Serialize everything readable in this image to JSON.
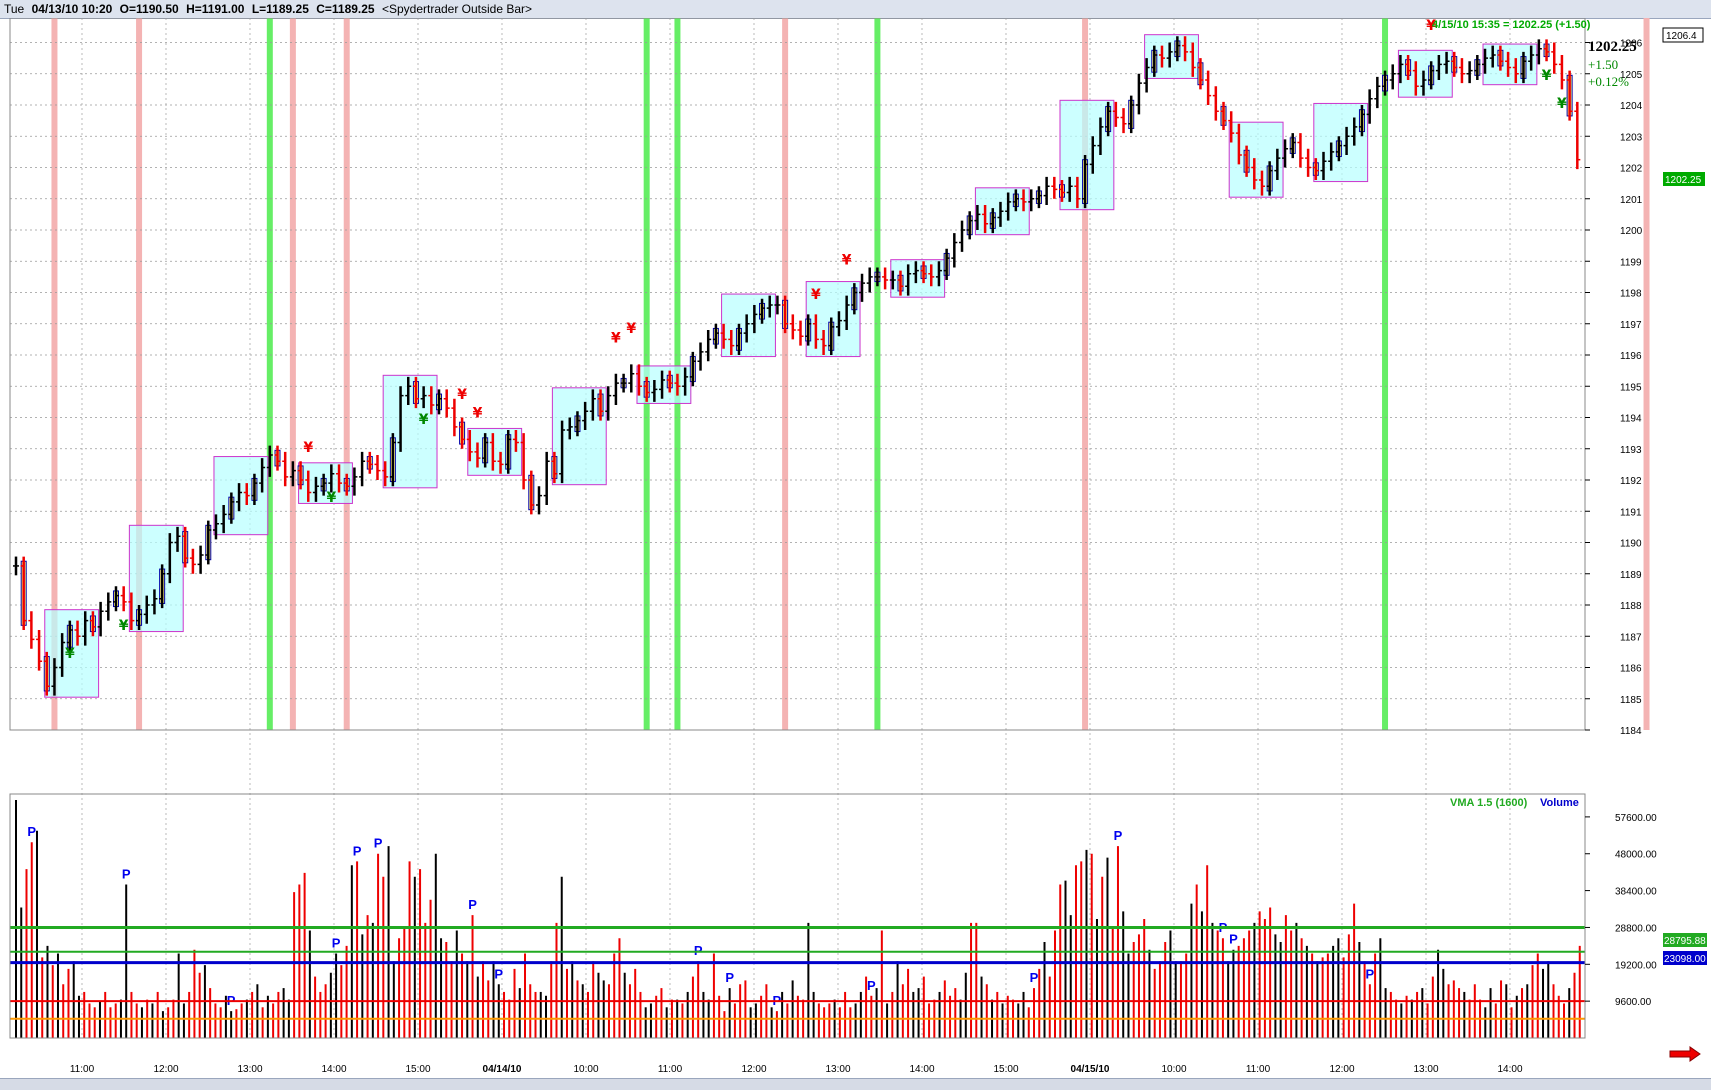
{
  "header": {
    "day": "Tue",
    "date_time": "04/13/10 10:20",
    "open": "O=1190.50",
    "high": "H=1191.00",
    "low": "L=1189.25",
    "close": "C=1189.25",
    "study": "<Spydertrader Outside Bar>"
  },
  "quote": {
    "timestamp": "4/15/10 15:35 = 1202.25 (+1.50)",
    "last": "1202.25",
    "change": "+1.50",
    "change_pct": "+0.12%",
    "axis_high_label": "1206.4",
    "axis_last_label": "1202.25"
  },
  "volume_panel": {
    "vma_label": "VMA 1.5 (1600)",
    "volume_label": "Volume",
    "vma_value_label": "28795.88",
    "volume_value_label": "23098.00"
  },
  "colors": {
    "up_bar": "#000000",
    "down_bar": "#ee0000",
    "inside_bar_fill": "#fff27a",
    "box_fill": "#b7ffff",
    "box_border": "#cc33cc",
    "green_band": "#66ee66",
    "red_band": "#f4b3b3",
    "vma_line": "#22aa22",
    "volume_avg_line": "#0000cc",
    "pivot_marker": "#0000ee",
    "yen_up": "#008800",
    "yen_down": "#ee0000"
  },
  "chart_data": [
    {
      "type": "candlestick",
      "title": "",
      "ylim": [
        1184,
        1206.4
      ],
      "y_ticks": [
        1184,
        1185,
        1186,
        1187,
        1188,
        1189,
        1190,
        1191,
        1192,
        1193,
        1194,
        1195,
        1196,
        1197,
        1198,
        1199,
        1200,
        1201,
        1202,
        1203,
        1204,
        1205,
        1206
      ],
      "x_ticks": [
        "11:00",
        "12:00",
        "13:00",
        "14:00",
        "15:00",
        "04/14/10",
        "10:00",
        "11:00",
        "12:00",
        "13:00",
        "14:00",
        "15:00",
        "04/15/10",
        "10:00",
        "11:00",
        "12:00",
        "13:00",
        "14:00"
      ],
      "bar_interval": "5 min",
      "series": [
        {
          "name": "04/13/10",
          "close": [
            1189.25,
            1187.5,
            1186.9,
            1186.2,
            1185.4,
            1186.0,
            1186.8,
            1187.2,
            1187.0,
            1187.5,
            1187.3,
            1187.8,
            1188.1,
            1188.3,
            1188.1,
            1187.5,
            1187.7,
            1188.0,
            1188.2,
            1189.0,
            1190.0,
            1190.2,
            1189.5,
            1189.3,
            1189.6,
            1190.4,
            1190.6,
            1190.9,
            1191.3,
            1191.6,
            1191.5,
            1191.9,
            1192.4,
            1192.8,
            1192.6,
            1192.1,
            1192.3,
            1192.0,
            1191.6,
            1191.8,
            1191.9,
            1192.2,
            1191.9,
            1191.8,
            1192.1,
            1192.6,
            1192.5,
            1192.3,
            1192.1,
            1193.2,
            1194.7,
            1195.0,
            1194.6,
            1194.7,
            1194.4,
            1194.6,
            1194.3,
            1193.7
          ]
        },
        {
          "name": "04/14/10",
          "close": [
            1193.3,
            1192.9,
            1192.7,
            1193.2,
            1192.6,
            1192.5,
            1193.3,
            1193.2,
            1192.0,
            1191.2,
            1191.5,
            1192.6,
            1192.2,
            1193.6,
            1193.7,
            1193.9,
            1194.2,
            1194.6,
            1194.2,
            1194.7,
            1195.1,
            1195.1,
            1195.4,
            1195.0,
            1194.8,
            1194.9,
            1195.2,
            1195.1,
            1195.0,
            1195.3,
            1195.8,
            1196.1,
            1196.5,
            1196.7,
            1196.5,
            1196.3,
            1196.7,
            1197.0,
            1197.3,
            1197.5,
            1197.6,
            1197.6,
            1197.0,
            1196.8,
            1196.6,
            1197.0,
            1196.5,
            1196.3,
            1196.9,
            1197.1,
            1197.6,
            1198.0,
            1198.3,
            1198.5,
            1198.5,
            1198.4,
            1198.4,
            1198.2,
            1198.6,
            1198.7,
            1198.6,
            1198.5,
            1198.7,
            1199.1,
            1199.6,
            1200.0,
            1200.3,
            1200.5,
            1200.2,
            1200.4,
            1200.6,
            1200.9,
            1201.0,
            1200.9,
            1201.0,
            1201.1,
            1201.4,
            1201.3,
            1201.2,
            1201.4,
            1201.0
          ]
        },
        {
          "name": "04/15/10",
          "close": [
            1202.1,
            1202.7,
            1203.3,
            1203.8,
            1203.6,
            1203.4,
            1204.0,
            1204.7,
            1205.2,
            1205.6,
            1205.5,
            1205.7,
            1205.9,
            1205.7,
            1205.2,
            1204.8,
            1204.3,
            1203.8,
            1203.5,
            1203.1,
            1202.4,
            1202.0,
            1201.6,
            1201.4,
            1201.9,
            1202.3,
            1202.6,
            1202.8,
            1202.3,
            1202.0,
            1201.9,
            1202.2,
            1202.5,
            1202.7,
            1203.0,
            1203.3,
            1203.7,
            1204.2,
            1204.6,
            1204.8,
            1205.0,
            1205.3,
            1205.1,
            1204.6,
            1204.8,
            1205.1,
            1205.3,
            1205.4,
            1205.2,
            1205.0,
            1205.1,
            1205.3,
            1205.5,
            1205.6,
            1205.4,
            1205.2,
            1205.0,
            1205.4,
            1205.6,
            1205.8,
            1205.7,
            1205.3,
            1204.8,
            1203.8,
            1202.25
          ]
        }
      ]
    },
    {
      "type": "bar",
      "title": "",
      "ylim": [
        0,
        62000
      ],
      "y_ticks": [
        9600,
        19200,
        28800,
        38400,
        48000,
        57600
      ],
      "series": [
        {
          "name": "Volume",
          "values": [
            62000,
            34000,
            44000,
            51000,
            54000,
            21000,
            24000,
            19000,
            22000,
            14000,
            18000,
            20000,
            11000,
            12000,
            9000,
            8000,
            9500,
            12000,
            8000,
            9000,
            10000,
            40000,
            12000,
            9000,
            8000,
            10000,
            9000,
            12000,
            7000,
            8000,
            10000,
            22000,
            9000,
            12000,
            23000,
            17000,
            19000,
            13000,
            9000,
            8000,
            11000,
            7000,
            7500,
            9000,
            10000,
            12000,
            14000,
            8000,
            11000,
            9000,
            12000,
            13000,
            10000,
            38000,
            40000,
            43000,
            28000,
            16000,
            12000,
            14000,
            17000,
            22000,
            19000,
            24000,
            45000,
            46000,
            27000,
            32000,
            30000,
            48000,
            42000,
            50000,
            20000,
            26000,
            29000,
            46000,
            42000,
            44000,
            30000,
            36000,
            48000,
            26000,
            25000,
            20000,
            28000,
            22000,
            20000,
            32000,
            16000,
            20000,
            15000,
            20000,
            14000,
            12000,
            10000,
            18000,
            13000,
            22000,
            14000,
            12000,
            12000,
            11000,
            20000,
            30000,
            42000,
            18000,
            20000,
            15000,
            14000,
            12000,
            20000,
            17000,
            15000,
            14000,
            22000,
            26000,
            17000,
            14000,
            18000,
            12000,
            8000,
            9000,
            11000,
            13000,
            8000,
            10000,
            10000,
            9000,
            12000,
            16000,
            20000,
            12000,
            10000,
            22000,
            11000,
            7000,
            13000,
            9000,
            14000,
            15000,
            8000,
            9000,
            11000,
            14000,
            8000,
            7000,
            12000,
            9000,
            15000,
            11000,
            10000,
            30000,
            12000,
            9000,
            8000,
            9000,
            10000,
            8000,
            12000,
            8000,
            9000,
            12000,
            16000,
            11000,
            13000,
            28000,
            9000,
            12000,
            20000,
            14000,
            18000,
            12000,
            13000,
            16000,
            9000,
            10000,
            12000,
            15000,
            11000,
            13000,
            10000,
            17000,
            30000,
            30000,
            16000,
            14000,
            10000,
            12000,
            9000,
            11000,
            10000,
            9000,
            12000,
            8000,
            13000,
            18000,
            25000,
            16000,
            28000,
            40000,
            41000,
            32000,
            45000,
            46000,
            49000,
            48000,
            31000,
            42000,
            47000,
            29000,
            50000,
            33000,
            22000,
            25000,
            27000,
            31000,
            23000,
            18000,
            20000,
            25000,
            28000,
            20000,
            20000,
            22000,
            35000,
            40000,
            33000,
            45000,
            30000,
            28000,
            26000,
            20000,
            23000,
            24000,
            26000,
            28000,
            30000,
            33000,
            31000,
            34000,
            27000,
            25000,
            32000,
            28000,
            30000,
            26000,
            24000,
            22000,
            20000,
            21000,
            22000,
            24000,
            26000,
            21000,
            27000,
            35000,
            25000,
            20000,
            14000,
            22000,
            26000,
            13000,
            12000,
            10000,
            9000,
            11000,
            10000,
            12000,
            13000,
            9000,
            16000,
            23000,
            18000,
            14000,
            15000,
            13000,
            12000,
            10000,
            14000,
            10000,
            8000,
            13000,
            9000,
            15000,
            14000,
            8000,
            11000,
            13000,
            14000,
            19000,
            22000,
            18000,
            20000,
            14000,
            11000,
            9000,
            13000,
            17000,
            24000
          ]
        }
      ],
      "reference_lines": [
        {
          "name": "VMA 1.5 (1600)",
          "value": 28795.88
        },
        {
          "name": "Volume",
          "value": 23098.0
        }
      ]
    }
  ]
}
